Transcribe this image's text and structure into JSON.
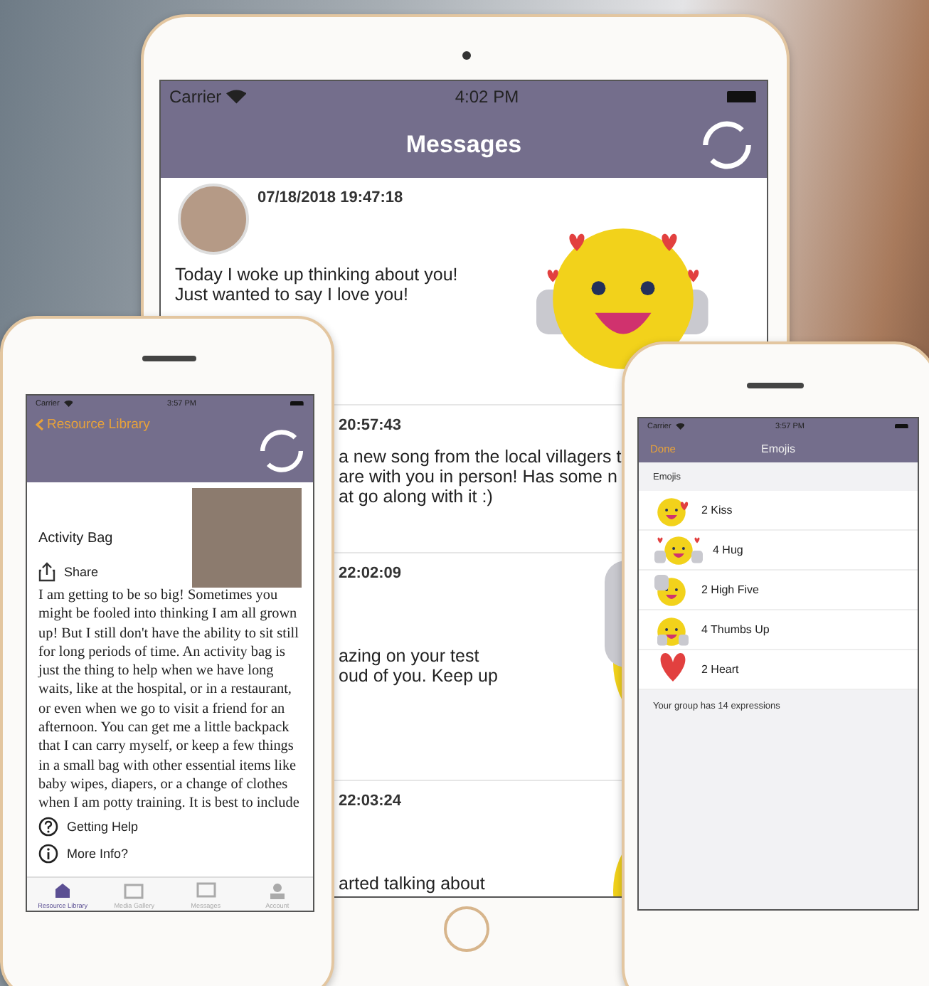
{
  "tablet": {
    "status_bar": {
      "carrier": "Carrier",
      "time": "4:02 PM"
    },
    "title": "Messages",
    "messages": [
      {
        "timestamp": "07/18/2018 19:47:18",
        "lines": [
          "Today I woke up thinking about you!",
          "Just wanted to say I love you!"
        ],
        "avatar": true,
        "kind": "hearts"
      },
      {
        "timestamp": "20:57:43",
        "lines": [
          "a new song from the local villagers t",
          "are with you in person! Has some n",
          "at go along with it :)"
        ],
        "avatar": false,
        "kind": "plain"
      },
      {
        "timestamp": "22:02:09",
        "lines": [
          "azing on your test",
          "oud of you.  Keep up"
        ],
        "avatar": false,
        "kind": "highfive"
      },
      {
        "timestamp": "22:03:24",
        "lines": [
          "arted talking about"
        ],
        "avatar": false,
        "kind": "face"
      }
    ]
  },
  "library_phone": {
    "status_bar": {
      "carrier": "Carrier",
      "time": "3:57 PM"
    },
    "back": "Resource Library",
    "title": "Activity Bag",
    "share": "Share",
    "body": "I am getting to be so big! Sometimes you might be fooled into thinking I am all grown up! But I still don't have the ability to sit still for long periods of time. An activity bag is just the thing to help when we have long waits, like at the hospital, or in a restaurant, or even when we go to visit a friend for an afternoon. You can get me a little backpack that I can carry myself, or keep a few things in a small bag with other essential items like baby wipes, diapers, or a change of clothes when I am potty training. It is best to include",
    "links": [
      {
        "kind": "help",
        "label": "Getting Help"
      },
      {
        "kind": "info",
        "label": "More Info?"
      }
    ],
    "tabs": [
      {
        "kind": "library",
        "label": "Resource Library",
        "selected": true
      },
      {
        "kind": "gallery",
        "label": "Media Gallery",
        "selected": false
      },
      {
        "kind": "messages",
        "label": "Messages",
        "selected": false
      },
      {
        "kind": "account",
        "label": "Account",
        "selected": false
      }
    ]
  },
  "emoji_phone": {
    "status_bar": {
      "carrier": "Carrier",
      "time": "3:57 PM"
    },
    "done": "Done",
    "title": "Emojis",
    "section": "Emojis",
    "rows": [
      {
        "kind": "kiss",
        "label": "2 Kiss"
      },
      {
        "kind": "hug",
        "label": "4 Hug"
      },
      {
        "kind": "highfive",
        "label": "2 High Five"
      },
      {
        "kind": "thumbsup",
        "label": "4 Thumbs Up"
      },
      {
        "kind": "heart",
        "label": "2 Heart"
      }
    ],
    "footer": "Your group has 14 expressions"
  }
}
